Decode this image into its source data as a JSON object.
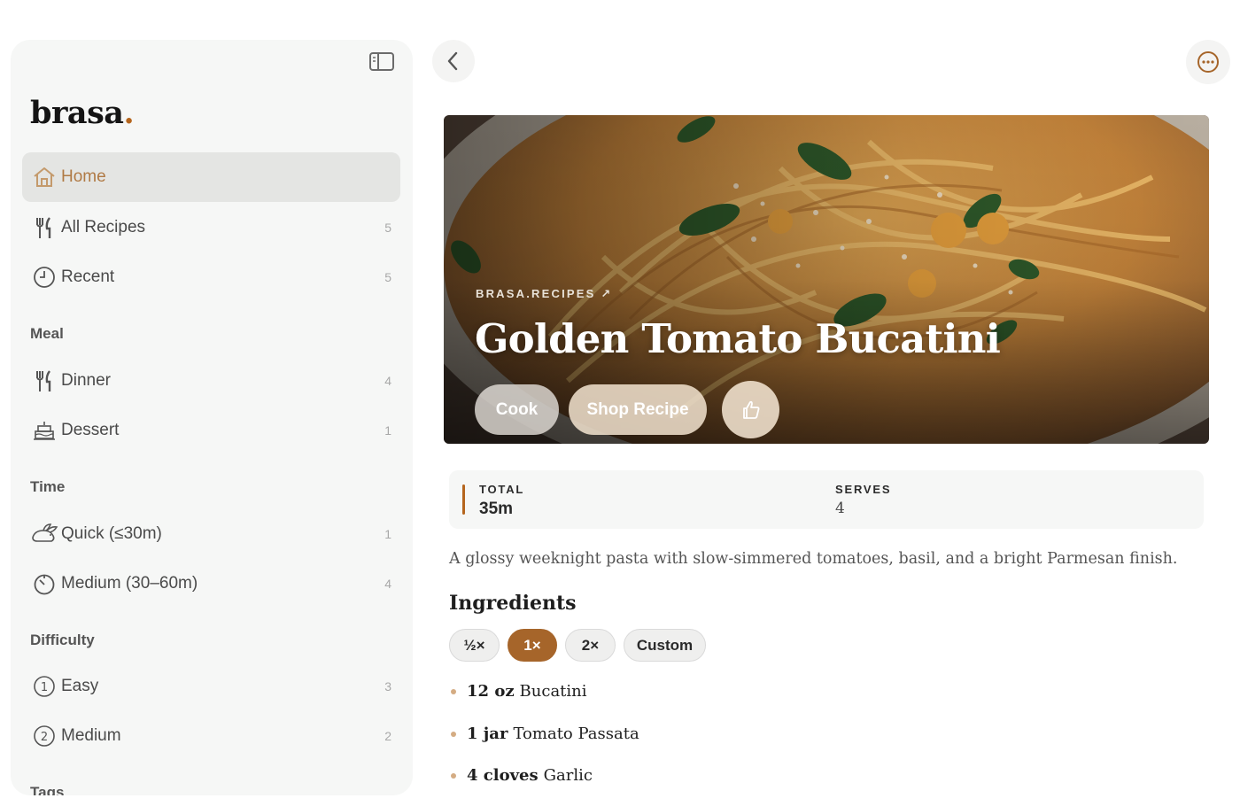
{
  "sidebar": {
    "logo": "brasa",
    "logo_dot": ".",
    "items": [
      {
        "label": "Home",
        "count": ""
      },
      {
        "label": "All Recipes",
        "count": "5"
      },
      {
        "label": "Recent",
        "count": "5"
      }
    ],
    "sections": [
      {
        "title": "Meal",
        "items": [
          {
            "label": "Dinner",
            "count": "4"
          },
          {
            "label": "Dessert",
            "count": "1"
          }
        ]
      },
      {
        "title": "Time",
        "items": [
          {
            "label": "Quick (≤30m)",
            "count": "1"
          },
          {
            "label": "Medium (30–60m)",
            "count": "4"
          }
        ]
      },
      {
        "title": "Difficulty",
        "items": [
          {
            "label": "Easy",
            "count": "3"
          },
          {
            "label": "Medium",
            "count": "2"
          }
        ]
      },
      {
        "title": "Tags"
      }
    ]
  },
  "recipe": {
    "source": "BRASA.RECIPES ↗",
    "title": "Golden Tomato Bucatini",
    "buttons": {
      "cook": "Cook",
      "shop": "Shop Recipe"
    },
    "stats": {
      "total_label": "TOTAL",
      "total_value": "35m",
      "serves_label": "SERVES",
      "serves_value": "4"
    },
    "description": "A glossy weeknight pasta with slow-simmered tomatoes, basil, and a bright Parmesan finish.",
    "ingredients_title": "Ingredients",
    "scales": [
      "½×",
      "1×",
      "2×",
      "Custom"
    ],
    "ingredients": [
      {
        "qty": "12 oz",
        "name": "Bucatini"
      },
      {
        "qty": "1 jar",
        "name": "Tomato Passata"
      },
      {
        "qty": "4 cloves",
        "name": "Garlic"
      }
    ]
  },
  "colors": {
    "accent": "#a6652a",
    "sidebar_bg": "#f6f7f6"
  }
}
